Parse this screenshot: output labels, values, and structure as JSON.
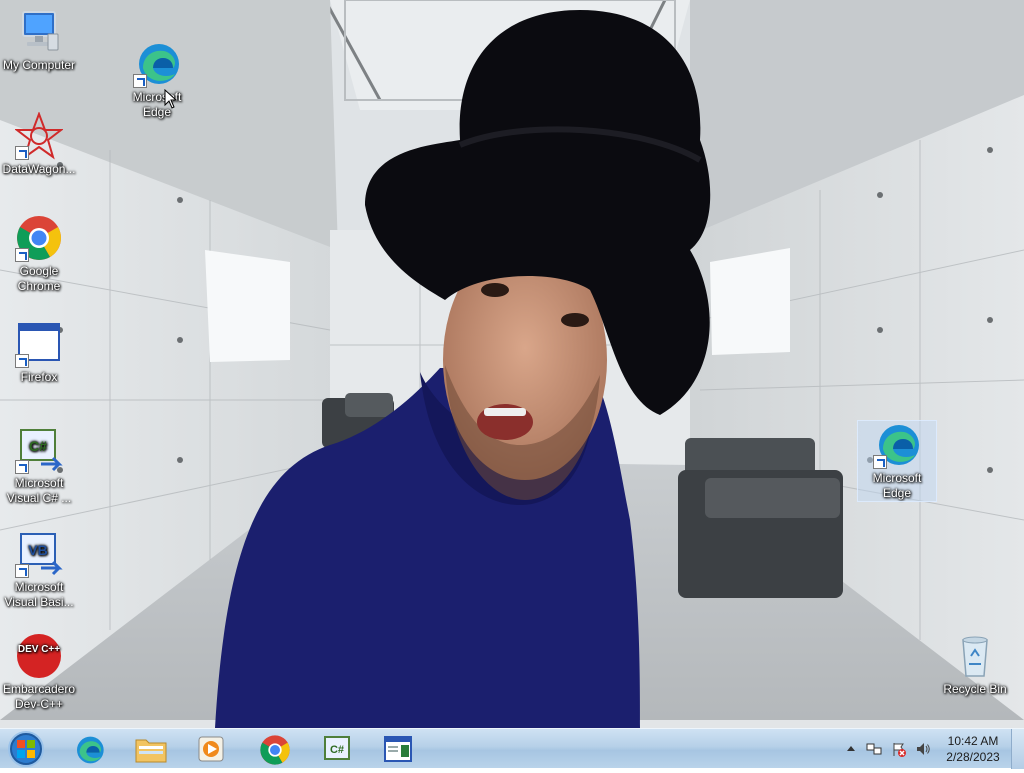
{
  "desktop": {
    "icons": [
      {
        "label": "My Computer"
      },
      {
        "label": "Microsoft Edge"
      },
      {
        "label": "DataWagon..."
      },
      {
        "label": "Google Chrome"
      },
      {
        "label": "Firefox"
      },
      {
        "label": "Microsoft Visual C# ..."
      },
      {
        "label": "Microsoft Visual Basi..."
      },
      {
        "label": "Embarcadero Dev-C++"
      },
      {
        "label": "Microsoft Edge"
      },
      {
        "label": "Recycle Bin"
      }
    ],
    "icon_badges": {
      "csharp": "C#",
      "vb": "VB",
      "devcpp": "DEV C++"
    }
  },
  "taskbar": {
    "pinned": [
      "start-orb",
      "edge-icon",
      "file-explorer-icon",
      "media-player-icon",
      "chrome-icon",
      "csharp-icon",
      "window-app-icon"
    ],
    "pinned_badge_csharp": "C#"
  },
  "tray": {
    "time": "10:42 AM",
    "date": "2/28/2023"
  },
  "colors": {
    "taskbar": "#b6d0e8",
    "selection": "#bed7f5",
    "sweater": "#1b1f6e",
    "hat": "#0b0b10"
  }
}
